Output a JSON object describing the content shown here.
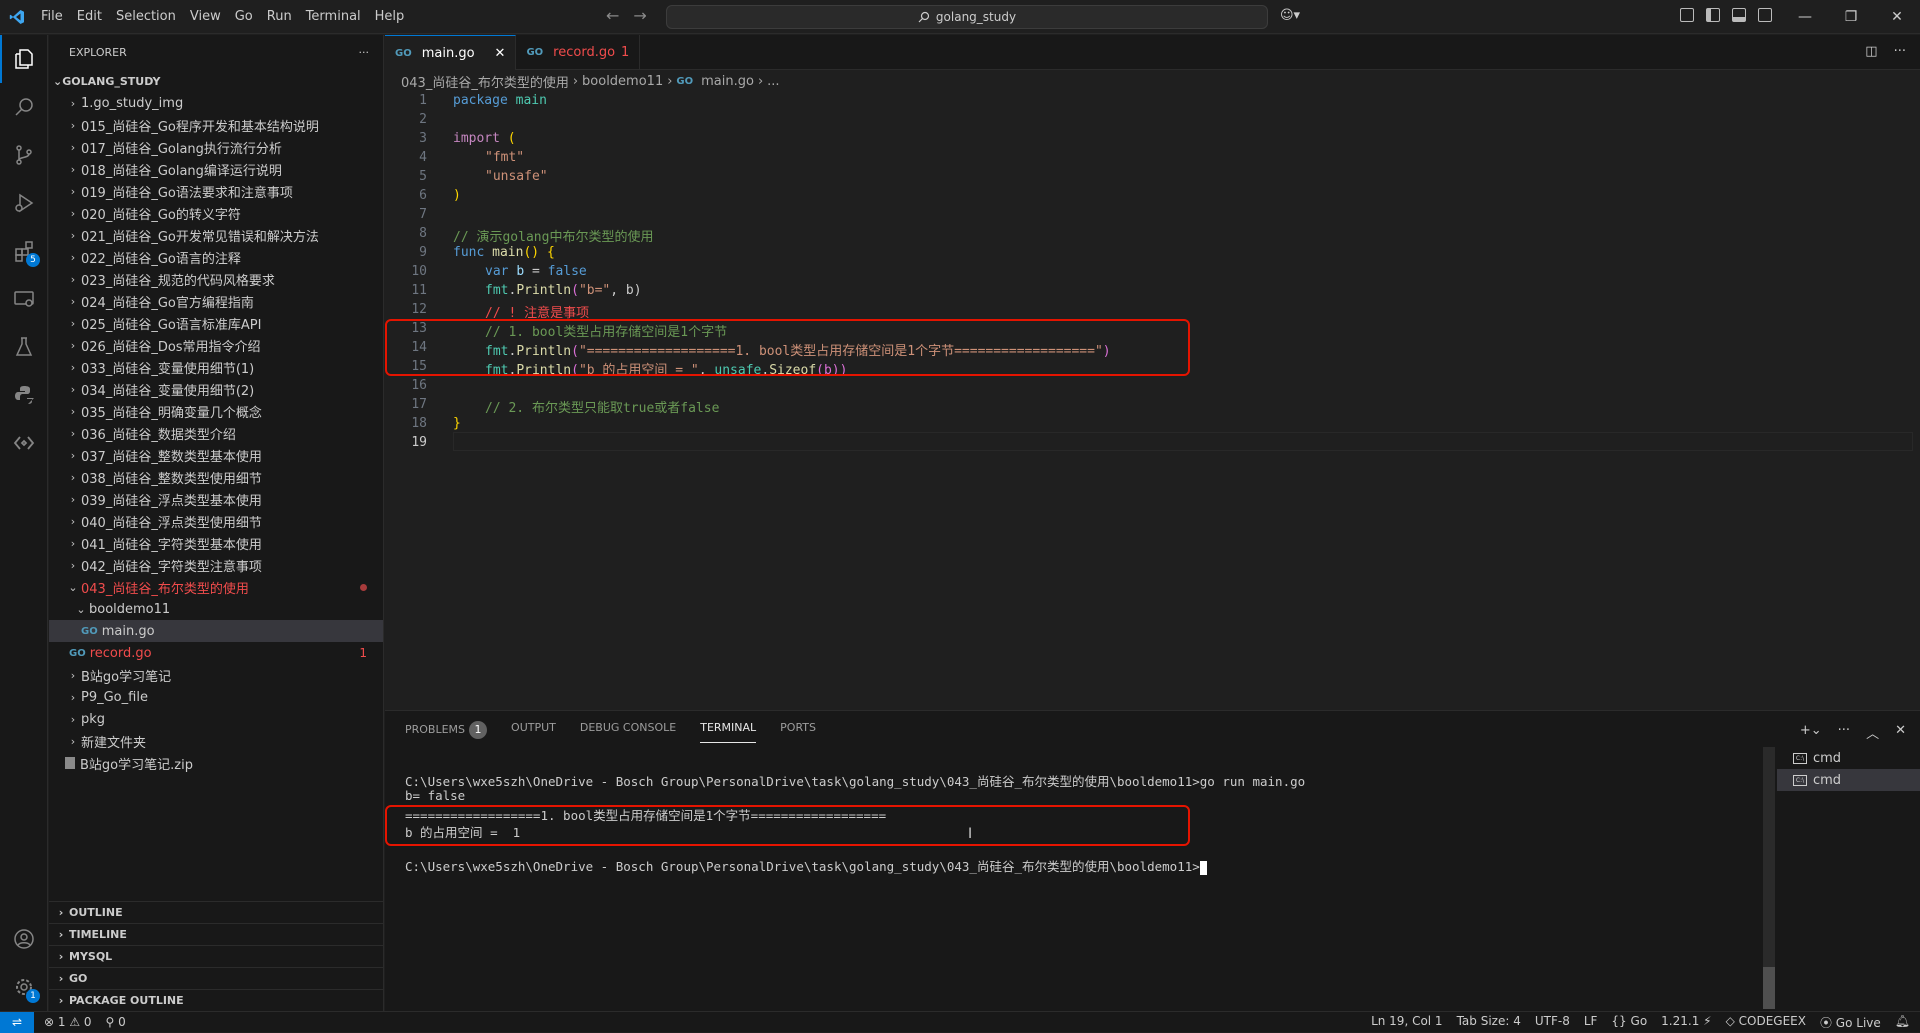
{
  "menu": [
    "File",
    "Edit",
    "Selection",
    "View",
    "Go",
    "Run",
    "Terminal",
    "Help"
  ],
  "search": {
    "text": "golang_study"
  },
  "explorer": {
    "title": "EXPLORER",
    "root": "GOLANG_STUDY",
    "items": [
      {
        "label": "1.go_study_img"
      },
      {
        "label": "015_尚硅谷_Go程序开发和基本结构说明"
      },
      {
        "label": "017_尚硅谷_Golang执行流行分析"
      },
      {
        "label": "018_尚硅谷_Golang编译运行说明"
      },
      {
        "label": "019_尚硅谷_Go语法要求和注意事项"
      },
      {
        "label": "020_尚硅谷_Go的转义字符"
      },
      {
        "label": "021_尚硅谷_Go开发常见错误和解决方法"
      },
      {
        "label": "022_尚硅谷_Go语言的注释"
      },
      {
        "label": "023_尚硅谷_规范的代码风格要求"
      },
      {
        "label": "024_尚硅谷_Go官方编程指南"
      },
      {
        "label": "025_尚硅谷_Go语言标准库API"
      },
      {
        "label": "026_尚硅谷_Dos常用指令介绍"
      },
      {
        "label": "033_尚硅谷_变量使用细节(1)"
      },
      {
        "label": "034_尚硅谷_变量使用细节(2)"
      },
      {
        "label": "035_尚硅谷_明确变量几个概念"
      },
      {
        "label": "036_尚硅谷_数据类型介绍"
      },
      {
        "label": "037_尚硅谷_整数类型基本使用"
      },
      {
        "label": "038_尚硅谷_整数类型使用细节"
      },
      {
        "label": "039_尚硅谷_浮点类型基本使用"
      },
      {
        "label": "040_尚硅谷_浮点类型使用细节"
      },
      {
        "label": "041_尚硅谷_字符类型基本使用"
      },
      {
        "label": "042_尚硅谷_字符类型注意事项"
      },
      {
        "label": "043_尚硅谷_布尔类型的使用"
      },
      {
        "label": "booldemo11"
      },
      {
        "label": "main.go"
      },
      {
        "label": "record.go",
        "count": "1"
      },
      {
        "label": "B站go学习笔记"
      },
      {
        "label": "P9_Go_file"
      },
      {
        "label": "pkg"
      },
      {
        "label": "新建文件夹"
      },
      {
        "label": "B站go学习笔记.zip"
      }
    ],
    "sections": [
      "OUTLINE",
      "TIMELINE",
      "MYSQL",
      "GO",
      "PACKAGE OUTLINE"
    ]
  },
  "activity": {
    "extensions_badge": "5",
    "settings_badge": "1"
  },
  "tabs": [
    {
      "label": "main.go",
      "icon": "go-file-icon"
    },
    {
      "label": "record.go",
      "count": "1",
      "icon": "go-file-icon"
    }
  ],
  "breadcrumb": [
    "043_尚硅谷_布尔类型的使用",
    "booldemo11",
    "main.go",
    "..."
  ],
  "code": {
    "line_numbers": [
      "1",
      "2",
      "3",
      "4",
      "5",
      "6",
      "7",
      "8",
      "9",
      "10",
      "11",
      "12",
      "13",
      "14",
      "15",
      "16",
      "17",
      "18",
      "19"
    ],
    "l1a": "package",
    "l1b": "main",
    "l3a": "import",
    "l3b": "(",
    "l4": "\"fmt\"",
    "l5": "\"unsafe\"",
    "l6": ")",
    "l8": "// 演示golang中布尔类型的使用",
    "l9a": "func",
    "l9b": "main",
    "l9c": "()",
    "l9d": "{",
    "l10a": "var",
    "l10b": "b",
    "l10c": "=",
    "l10d": "false",
    "l11a": "fmt",
    "l11b": "Println",
    "l11c": "\"b=\"",
    "l11d": ", b)",
    "l12": "// ! 注意是事项",
    "l13": "// 1. bool类型占用存储空间是1个字节",
    "l14a": "fmt",
    "l14b": "Println",
    "l14c": "\"===================1. bool类型占用存储空间是1个字节==================\"",
    "l15a": "fmt",
    "l15b": "Println",
    "l15c": "\"b 的占用空间 = \"",
    "l15d": "unsafe",
    "l15e": "Sizeof",
    "l15f": "(b))",
    "l17": "// 2. 布尔类型只能取true或者false",
    "l18": "}"
  },
  "panel": {
    "tabs": [
      "PROBLEMS",
      "OUTPUT",
      "DEBUG CONSOLE",
      "TERMINAL",
      "PORTS"
    ],
    "problems_count": "1",
    "terminal_lines": [
      "C:\\Users\\wxe5szh\\OneDrive - Bosch Group\\PersonalDrive\\task\\golang_study\\043_尚硅谷_布尔类型的使用\\booldemo11>go run main.go",
      "b= false",
      "==================1. bool类型占用存储空间是1个字节==================",
      "b 的占用空间 =  1",
      "",
      "C:\\Users\\wxe5szh\\OneDrive - Bosch Group\\PersonalDrive\\task\\golang_study\\043_尚硅谷_布尔类型的使用\\booldemo11>"
    ],
    "terminals": [
      "cmd",
      "cmd"
    ]
  },
  "status": {
    "errors": "1",
    "warnings": "0",
    "ports": "0",
    "position": "Ln 19, Col 1",
    "tab_size": "Tab Size: 4",
    "encoding": "UTF-8",
    "eol": "LF",
    "language": "Go",
    "go_version": "1.21.1",
    "codegeex": "CODEGEEX",
    "golive": "Go Live"
  },
  "colors": {
    "accent": "#0078d4",
    "error": "#f14c4c",
    "highlight_box": "#e51400"
  }
}
